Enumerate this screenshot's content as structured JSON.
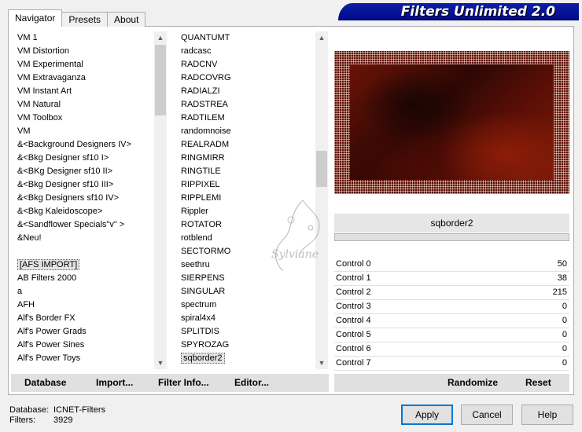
{
  "banner": {
    "title": "Filters Unlimited 2.0"
  },
  "tabs": [
    {
      "label": "Navigator",
      "active": true
    },
    {
      "label": "Presets",
      "active": false
    },
    {
      "label": "About",
      "active": false
    }
  ],
  "categories": [
    "VM 1",
    "VM Distortion",
    "VM Experimental",
    "VM Extravaganza",
    "VM Instant Art",
    "VM Natural",
    "VM Toolbox",
    "VM",
    "&<Background Designers IV>",
    "&<Bkg Designer sf10 I>",
    "&<BKg Designer sf10 II>",
    "&<Bkg Designer sf10 III>",
    "&<Bkg Designers sf10 IV>",
    "&<Bkg Kaleidoscope>",
    "&<Sandflower Specials\"v\" >",
    "&Neu!",
    "",
    "[AFS IMPORT]",
    "AB Filters 2000",
    "a",
    "AFH",
    "Alf's Border FX",
    "Alf's Power Grads",
    "Alf's Power Sines",
    "Alf's Power Toys"
  ],
  "categories_selected": "[AFS IMPORT]",
  "filters": [
    "QUANTUMT",
    "radcasc",
    "RADCNV",
    "RADCOVRG",
    "RADIALZI",
    "RADSTREA",
    "RADTILEM",
    "randomnoise",
    "REALRADM",
    "RINGMIRR",
    "RINGTILE",
    "RIPPIXEL",
    "RIPPLEMI",
    "Rippler",
    "ROTATOR",
    "rotblend",
    "SECTORMO",
    "seethru",
    "SIERPENS",
    "SINGULAR",
    "spectrum",
    "spiral4x4",
    "SPLITDIS",
    "SPYROZAG",
    "sqborder2"
  ],
  "filters_selected": "sqborder2",
  "preview": {
    "filter_name": "sqborder2"
  },
  "controls": [
    {
      "label": "Control 0",
      "value": "50"
    },
    {
      "label": "Control 1",
      "value": "38"
    },
    {
      "label": "Control 2",
      "value": "215"
    },
    {
      "label": "Control 3",
      "value": "0"
    },
    {
      "label": "Control 4",
      "value": "0"
    },
    {
      "label": "Control 5",
      "value": "0"
    },
    {
      "label": "Control 6",
      "value": "0"
    },
    {
      "label": "Control 7",
      "value": "0"
    }
  ],
  "commands": {
    "database": "Database",
    "import": "Import...",
    "filter_info": "Filter Info...",
    "editor": "Editor...",
    "randomize": "Randomize",
    "reset": "Reset"
  },
  "info": {
    "database_label": "Database:",
    "database_value": "ICNET-Filters",
    "filters_label": "Filters:",
    "filters_value": "3929"
  },
  "buttons": {
    "apply": "Apply",
    "cancel": "Cancel",
    "help": "Help"
  },
  "watermark": {
    "text": "Sylviane"
  },
  "colors": {
    "banner": "#0e1ea8",
    "accent": "#0078d7"
  }
}
